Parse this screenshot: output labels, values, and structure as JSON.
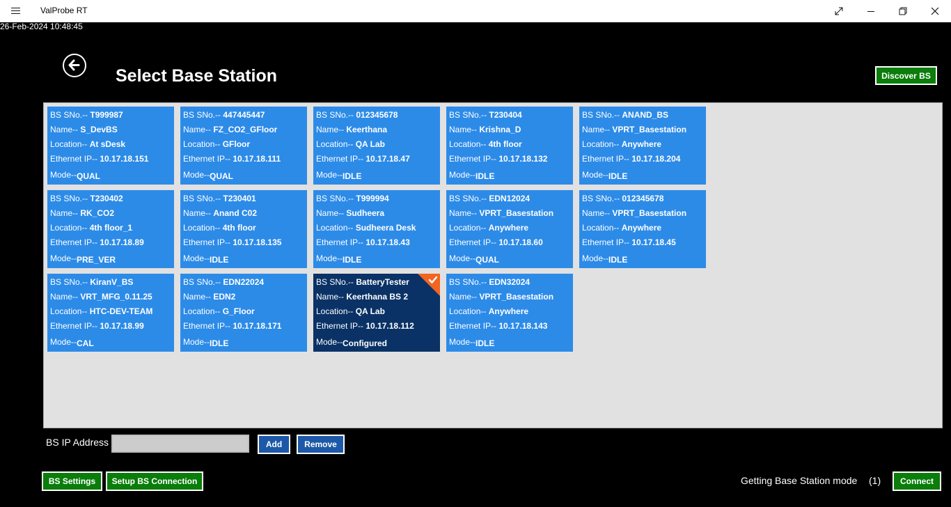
{
  "window": {
    "title": "ValProbe RT"
  },
  "header": {
    "timestamp": "26-Feb-2024 10:48:45",
    "title": "Select Base Station"
  },
  "buttons": {
    "discover": "Discover BS",
    "add": "Add",
    "remove": "Remove",
    "bs_settings": "BS Settings",
    "setup_connection": "Setup BS Connection",
    "connect": "Connect"
  },
  "labels": {
    "sno": "BS SNo.-- ",
    "name": "Name-- ",
    "location": "Location-- ",
    "ip": "Ethernet IP-- ",
    "mode": "Mode--"
  },
  "ip_field": {
    "label": "BS IP Address",
    "value": "",
    "placeholder": ""
  },
  "status": {
    "text": "Getting Base Station mode",
    "count": "(1)"
  },
  "colors": {
    "card": "#2d8be8",
    "card_selected": "#0a3266",
    "selected_corner": "#f26522",
    "panel": "#e1e1e1",
    "green_button": "#0a7d0a",
    "blue_button": "#1e58a8"
  },
  "stations": [
    {
      "sno": "T999987",
      "name": "S_DevBS",
      "location": "At sDesk",
      "ip": "10.17.18.151",
      "mode": "QUAL",
      "selected": false
    },
    {
      "sno": "447445447",
      "name": "FZ_CO2_GFloor",
      "location": "GFloor",
      "ip": "10.17.18.111",
      "mode": "QUAL",
      "selected": false
    },
    {
      "sno": "012345678",
      "name": "Keerthana",
      "location": "QA Lab",
      "ip": "10.17.18.47",
      "mode": "IDLE",
      "selected": false
    },
    {
      "sno": "T230404",
      "name": "Krishna_D",
      "location": "4th floor",
      "ip": "10.17.18.132",
      "mode": "IDLE",
      "selected": false
    },
    {
      "sno": "ANAND_BS",
      "name": "VPRT_Basestation",
      "location": "Anywhere",
      "ip": "10.17.18.204",
      "mode": "IDLE",
      "selected": false
    },
    {
      "sno": "T230402",
      "name": "RK_CO2",
      "location": "4th floor_1",
      "ip": "10.17.18.89",
      "mode": "PRE_VER",
      "selected": false
    },
    {
      "sno": "T230401",
      "name": "Anand C02",
      "location": "4th floor",
      "ip": "10.17.18.135",
      "mode": "IDLE",
      "selected": false
    },
    {
      "sno": "T999994",
      "name": "Sudheera",
      "location": "Sudheera Desk",
      "ip": "10.17.18.43",
      "mode": "IDLE",
      "selected": false
    },
    {
      "sno": "EDN12024",
      "name": "VPRT_Basestation",
      "location": "Anywhere",
      "ip": "10.17.18.60",
      "mode": "QUAL",
      "selected": false
    },
    {
      "sno": "012345678",
      "name": "VPRT_Basestation",
      "location": "Anywhere",
      "ip": "10.17.18.45",
      "mode": "IDLE",
      "selected": false
    },
    {
      "sno": "KiranV_BS",
      "name": "VRT_MFG_0.11.25",
      "location": "HTC-DEV-TEAM",
      "ip": "10.17.18.99",
      "mode": "CAL",
      "selected": false
    },
    {
      "sno": "EDN22024",
      "name": "EDN2",
      "location": "G_Floor",
      "ip": "10.17.18.171",
      "mode": "IDLE",
      "selected": false
    },
    {
      "sno": "BatteryTester",
      "name": "Keerthana BS 2",
      "location": "QA Lab",
      "ip": "10.17.18.112",
      "mode": "Configured",
      "selected": true
    },
    {
      "sno": "EDN32024",
      "name": "VPRT_Basestation",
      "location": "Anywhere",
      "ip": "10.17.18.143",
      "mode": "IDLE",
      "selected": false
    }
  ]
}
